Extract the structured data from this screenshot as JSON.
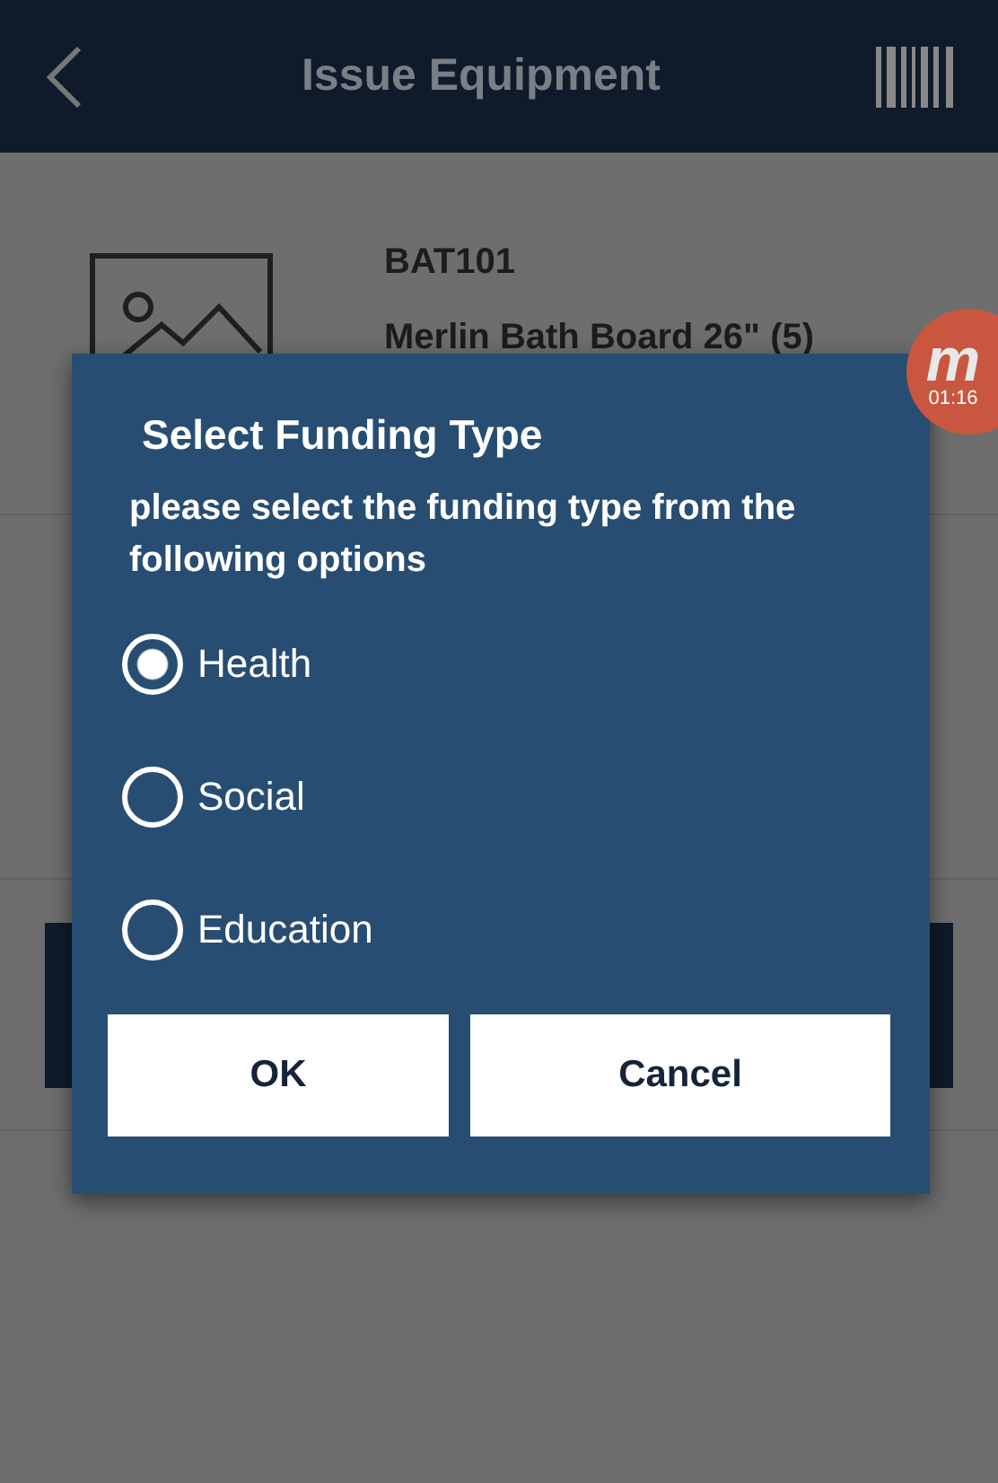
{
  "header": {
    "title": "Issue Equipment"
  },
  "item": {
    "code": "BAT101",
    "name": "Merlin Bath Board 26\" (5)"
  },
  "recorder": {
    "logo": "m",
    "time": "01:16"
  },
  "dialog": {
    "title": "Select Funding Type",
    "message": "please select the funding type from the following options",
    "options": [
      {
        "label": "Health",
        "selected": true
      },
      {
        "label": "Social",
        "selected": false
      },
      {
        "label": "Education",
        "selected": false
      }
    ],
    "buttons": [
      "OK",
      "Cancel"
    ]
  }
}
